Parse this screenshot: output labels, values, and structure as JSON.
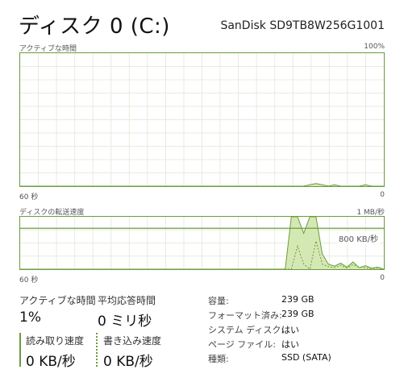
{
  "header": {
    "title": "ディスク 0 (C:)",
    "model": "SanDisk SD9TB8W256G1001"
  },
  "active_time_chart": {
    "label": "アクティブな時間",
    "max_label": "100%",
    "time_label": "60 秒",
    "min_label": "0",
    "max_percent": 100,
    "values": [
      0,
      0,
      0,
      0,
      0,
      0,
      0,
      0,
      0,
      0,
      0,
      0,
      0,
      0,
      0,
      0,
      0,
      0,
      0,
      0,
      0,
      0,
      0,
      0,
      0,
      0,
      0,
      0,
      0,
      0,
      0,
      0,
      0,
      0,
      0,
      0,
      0,
      0,
      0,
      0,
      0,
      0,
      0,
      0,
      0,
      0,
      0,
      1,
      2,
      1,
      0,
      1,
      0,
      0,
      0,
      0,
      1,
      0,
      0,
      0
    ]
  },
  "transfer_chart": {
    "label": "ディスクの転送速度",
    "max_label": "1 MB/秒",
    "time_label": "60 秒",
    "min_label": "0",
    "marker_label": "800 KB/秒",
    "max_kbps": 1024,
    "marker_kbps": 800,
    "read_kbps": [
      0,
      0,
      0,
      0,
      0,
      0,
      0,
      0,
      0,
      0,
      0,
      0,
      0,
      0,
      0,
      0,
      0,
      0,
      0,
      0,
      0,
      0,
      0,
      0,
      0,
      0,
      0,
      0,
      0,
      0,
      0,
      0,
      0,
      0,
      0,
      0,
      0,
      0,
      0,
      0,
      0,
      0,
      0,
      0,
      1024,
      1024,
      700,
      1024,
      1024,
      300,
      100,
      60,
      120,
      40,
      140,
      30,
      70,
      20,
      40,
      0
    ],
    "write_kbps": [
      0,
      0,
      0,
      0,
      0,
      0,
      0,
      0,
      0,
      0,
      0,
      0,
      0,
      0,
      0,
      0,
      0,
      0,
      0,
      0,
      0,
      0,
      0,
      0,
      0,
      0,
      0,
      0,
      0,
      0,
      0,
      0,
      0,
      0,
      0,
      0,
      0,
      0,
      0,
      0,
      0,
      0,
      0,
      0,
      0,
      450,
      100,
      0,
      550,
      100,
      50,
      30,
      80,
      20,
      90,
      40,
      30,
      10,
      20,
      0
    ]
  },
  "stats": {
    "active_time_label": "アクティブな時間",
    "active_time_value": "1%",
    "avg_response_label": "平均応答時間",
    "avg_response_value": "0 ミリ秒",
    "read_speed_label": "読み取り速度",
    "read_speed_value": "0 KB/秒",
    "write_speed_label": "書き込み速度",
    "write_speed_value": "0 KB/秒"
  },
  "properties": {
    "capacity_label": "容量:",
    "capacity_value": "239 GB",
    "formatted_label": "フォーマット済み:",
    "formatted_value": "239 GB",
    "system_disk_label": "システム ディスク:",
    "system_disk_value": "はい",
    "page_file_label": "ページ ファイル:",
    "page_file_value": "はい",
    "type_label": "種類:",
    "type_value": "SSD (SATA)"
  },
  "colors": {
    "accent": "#6c9b3e",
    "fill": "#d4e8b4",
    "grid": "#e6eddf"
  }
}
